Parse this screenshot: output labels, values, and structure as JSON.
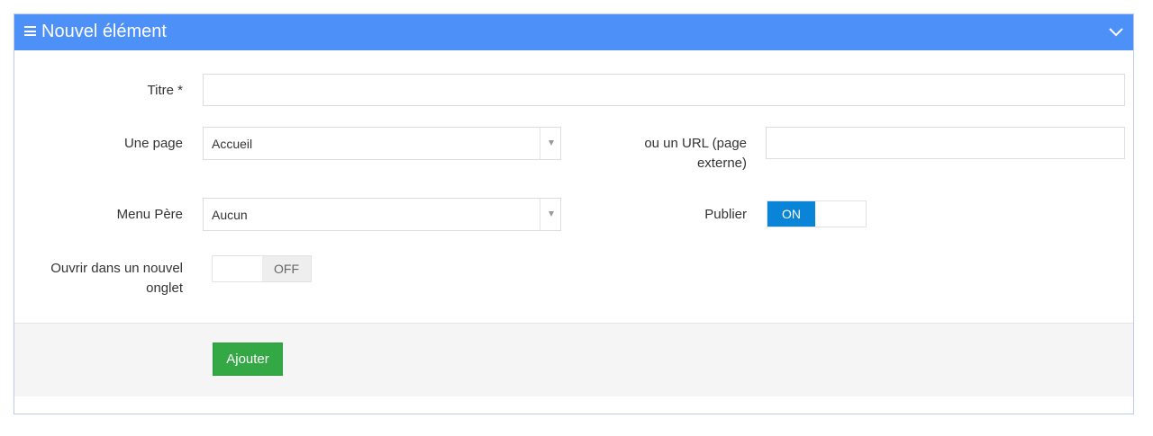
{
  "header": {
    "title": "Nouvel élément"
  },
  "form": {
    "titre": {
      "label": "Titre *",
      "value": ""
    },
    "page": {
      "label": "Une page",
      "selected": "Accueil"
    },
    "url": {
      "label_line1": "ou un URL (page",
      "label_line2": "externe)",
      "value": ""
    },
    "menu_pere": {
      "label": "Menu Père",
      "selected": "Aucun"
    },
    "publier": {
      "label": "Publier",
      "state_label": "ON",
      "state": true
    },
    "nouvel_onglet": {
      "label_line1": "Ouvrir dans un nouvel",
      "label_line2": "onglet",
      "state_label": "OFF",
      "state": false
    }
  },
  "footer": {
    "submit_label": "Ajouter"
  },
  "colors": {
    "header_bg": "#4d90f7",
    "toggle_on": "#0a84d6",
    "button_green": "#34a844"
  },
  "icons": {
    "menu": "hamburger-icon",
    "collapse": "chevron-down-icon",
    "select": "caret-down-icon"
  }
}
